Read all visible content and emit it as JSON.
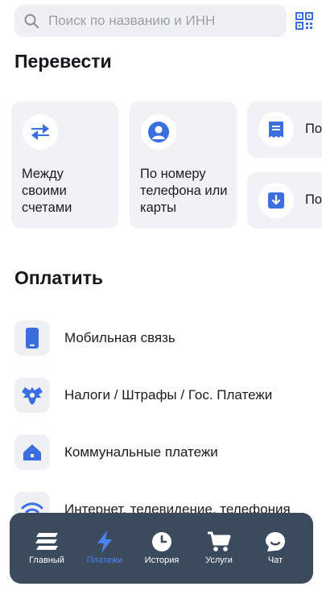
{
  "search": {
    "placeholder": "Поиск по названию и ИНН"
  },
  "transfer": {
    "title": "Перевести",
    "cards": [
      {
        "label": "Между своими счетами",
        "icon": "arrows-exchange-icon"
      },
      {
        "label": "По номеру телефона или карты",
        "icon": "person-icon"
      },
      {
        "label": "По",
        "icon": "receipt-icon"
      },
      {
        "label": "По",
        "icon": "download-icon"
      }
    ]
  },
  "pay": {
    "title": "Оплатить",
    "items": [
      {
        "label": "Мобильная связь",
        "icon": "phone-icon"
      },
      {
        "label": "Налоги / Штрафы / Гос. Платежи",
        "icon": "eagle-emblem-icon"
      },
      {
        "label": "Коммунальные платежи",
        "icon": "house-icon"
      },
      {
        "label": "Интернет, телевидение, телефония",
        "icon": "wifi-icon"
      }
    ]
  },
  "nav": {
    "items": [
      {
        "label": "Главный",
        "icon": "home-stack-icon",
        "active": false
      },
      {
        "label": "Платежи",
        "icon": "lightning-icon",
        "active": true
      },
      {
        "label": "История",
        "icon": "clock-icon",
        "active": false
      },
      {
        "label": "Услуги",
        "icon": "cart-icon",
        "active": false
      },
      {
        "label": "Чат",
        "icon": "chat-icon",
        "active": false
      }
    ]
  },
  "colors": {
    "accent": "#3b6fe0",
    "nav_bg": "#3c4a5e",
    "card_bg": "#f0f2f5",
    "active_nav": "#4a82f0"
  }
}
